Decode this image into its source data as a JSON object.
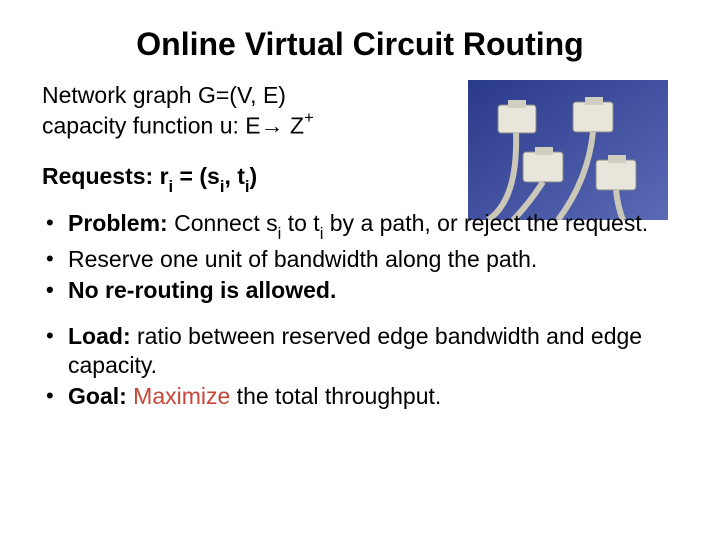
{
  "title": "Online Virtual Circuit Routing",
  "intro": {
    "line1_a": "Network graph G=(V, E)",
    "line2_a": "capacity function u: E",
    "line2_arrow": "→",
    "line2_b": " Z",
    "line2_sup": "+"
  },
  "requests": {
    "label_a": "Requests: ",
    "r": "r",
    "sub_i": "i",
    "eq": " = (s",
    "comma": ", t",
    "close": ")"
  },
  "bullets_a": {
    "b1_label": "Problem:",
    "b1_a": " Connect s",
    "b1_b": " to t",
    "b1_c": " by a path, or reject the request.",
    "b2": "Reserve one unit of bandwidth along the path.",
    "b3": "No re-routing is allowed."
  },
  "bullets_b": {
    "b4_label": "Load:",
    "b4_text": " ratio between reserved edge bandwidth and edge capacity.",
    "b5_label": "Goal:",
    "b5_a": " ",
    "b5_max": "Maximize",
    "b5_rest": " the total throughput."
  },
  "image_alt": "network-cables-photo"
}
